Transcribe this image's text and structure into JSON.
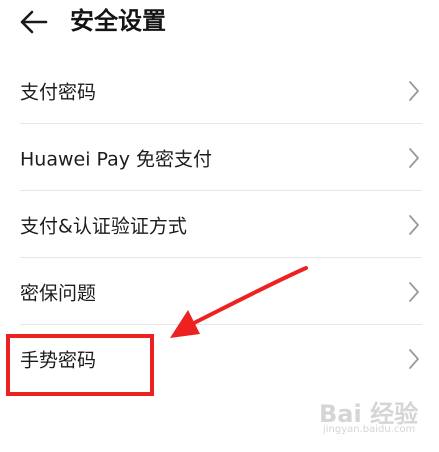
{
  "header": {
    "back_icon": "arrow-left-icon",
    "title": "安全设置"
  },
  "menu": {
    "items": [
      {
        "label": "支付密码",
        "icon": "chevron-right-icon"
      },
      {
        "label": "Huawei Pay 免密支付",
        "icon": "chevron-right-icon"
      },
      {
        "label": "支付&认证验证方式",
        "icon": "chevron-right-icon"
      },
      {
        "label": "密保问题",
        "icon": "chevron-right-icon"
      },
      {
        "label": "手势密码",
        "icon": "chevron-right-icon"
      }
    ]
  },
  "annotation": {
    "color": "#ee2121",
    "highlighted_item": "手势密码"
  },
  "watermark": {
    "main": "Bai 经验",
    "sub": "jingyan.baidu.com"
  }
}
